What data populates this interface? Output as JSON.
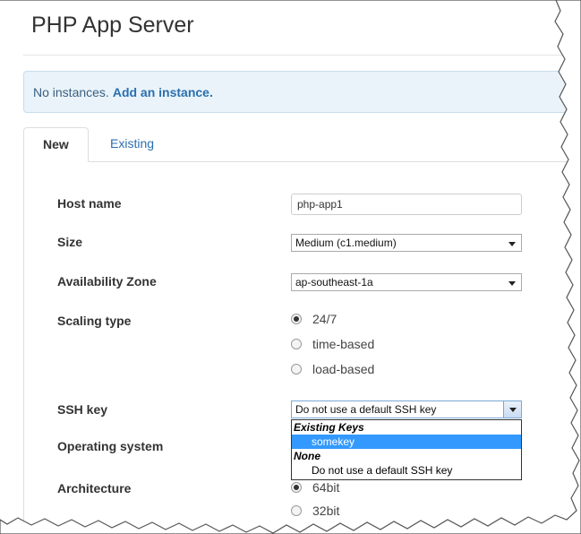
{
  "page": {
    "title": "PHP App Server"
  },
  "alert": {
    "text": "No instances.",
    "link": "Add an instance."
  },
  "tabs": [
    {
      "label": "New",
      "active": true
    },
    {
      "label": "Existing",
      "active": false
    }
  ],
  "form": {
    "host_name": {
      "label": "Host name",
      "value": "php-app1"
    },
    "size": {
      "label": "Size",
      "value": "Medium (c1.medium)"
    },
    "availability_zone": {
      "label": "Availability Zone",
      "value": "ap-southeast-1a"
    },
    "scaling_type": {
      "label": "Scaling type",
      "options": [
        "24/7",
        "time-based",
        "load-based"
      ],
      "selected": "24/7"
    },
    "ssh_key": {
      "label": "SSH key",
      "value": "Do not use a default SSH key",
      "dropdown": {
        "groups": [
          {
            "label": "Existing Keys",
            "items": [
              "somekey"
            ]
          },
          {
            "label": "None",
            "items": [
              "Do not use a default SSH key"
            ]
          }
        ],
        "highlighted": "somekey"
      }
    },
    "operating_system": {
      "label": "Operating system"
    },
    "architecture": {
      "label": "Architecture",
      "options": [
        "64bit",
        "32bit"
      ],
      "selected": "64bit"
    }
  },
  "colors": {
    "link": "#2a6fb0",
    "alert_bg": "#eaf3f9",
    "highlight": "#3399ff"
  }
}
